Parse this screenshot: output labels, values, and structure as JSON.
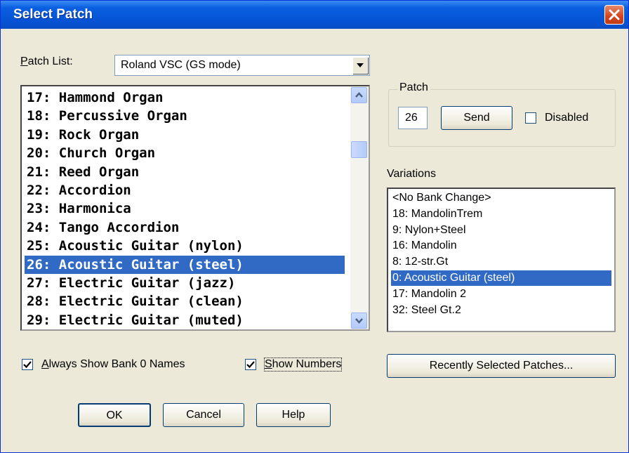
{
  "window": {
    "title": "Select Patch"
  },
  "patch_list": {
    "label": "Patch List:",
    "selected": "Roland VSC (GS mode)",
    "items": [
      {
        "text": "17: Hammond Organ",
        "selected": false
      },
      {
        "text": "18: Percussive Organ",
        "selected": false
      },
      {
        "text": "19: Rock Organ",
        "selected": false
      },
      {
        "text": "20: Church Organ",
        "selected": false
      },
      {
        "text": "21: Reed Organ",
        "selected": false
      },
      {
        "text": "22: Accordion",
        "selected": false
      },
      {
        "text": "23: Harmonica",
        "selected": false
      },
      {
        "text": "24: Tango Accordion",
        "selected": false
      },
      {
        "text": "25: Acoustic Guitar (nylon)",
        "selected": false
      },
      {
        "text": "26: Acoustic Guitar (steel)",
        "selected": true
      },
      {
        "text": "27: Electric Guitar (jazz)",
        "selected": false
      },
      {
        "text": "28: Electric Guitar (clean)",
        "selected": false
      },
      {
        "text": "29: Electric Guitar (muted)",
        "selected": false
      }
    ]
  },
  "options": {
    "always_show_bank0": {
      "label": "Always Show Bank 0 Names",
      "checked": true
    },
    "show_numbers": {
      "label": "Show Numbers",
      "checked": true
    }
  },
  "patch_group": {
    "title": "Patch",
    "number": "26",
    "send_label": "Send",
    "disabled_label": "Disabled",
    "disabled_checked": false
  },
  "variations": {
    "label": "Variations",
    "items": [
      {
        "text": "<No Bank Change>",
        "selected": false
      },
      {
        "text": "18: MandolinTrem",
        "selected": false
      },
      {
        "text": "9: Nylon+Steel",
        "selected": false
      },
      {
        "text": "16: Mandolin",
        "selected": false
      },
      {
        "text": "8: 12-str.Gt",
        "selected": false
      },
      {
        "text": "0: Acoustic Guitar (steel)",
        "selected": true
      },
      {
        "text": "17: Mandolin 2",
        "selected": false
      },
      {
        "text": "32: Steel Gt.2",
        "selected": false
      }
    ]
  },
  "buttons": {
    "recent": "Recently Selected Patches...",
    "ok": "OK",
    "cancel": "Cancel",
    "help": "Help"
  },
  "colors": {
    "selection": "#316ac5",
    "title_bar": "#0654d6",
    "face": "#ece9d8"
  },
  "icons": {
    "close": "close-icon",
    "dropdown": "chevron-down-icon",
    "scroll_up": "scroll-up-icon",
    "scroll_down": "scroll-down-icon"
  }
}
